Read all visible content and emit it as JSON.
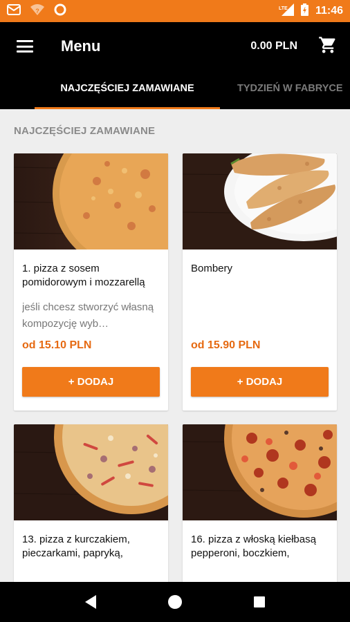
{
  "status_bar": {
    "time": "11:46",
    "network": "LTE",
    "left_icons": [
      "gmail-icon",
      "wifi-question-icon",
      "circle-app-icon"
    ],
    "right_icons": [
      "lte-icon",
      "signal-icon",
      "battery-icon"
    ]
  },
  "app_bar": {
    "title": "Menu",
    "cart_total": "0.00 PLN",
    "menu_icon": "hamburger-icon",
    "cart_icon": "cart-icon"
  },
  "tabs": [
    {
      "label": "NAJCZĘŚCIEJ ZAMAWIANE",
      "active": true
    },
    {
      "label": "TYDZIEŃ W FABRYCE",
      "active": false
    }
  ],
  "section": {
    "title": "NAJCZĘŚCIEJ ZAMAWIANE"
  },
  "products": [
    {
      "title": "1. pizza z sosem pomidorowym i mozzarellą",
      "description": "jeśli chcesz stworzyć własną kompozycję wyb…",
      "price": "od 15.10 PLN",
      "button": "+ DODAJ"
    },
    {
      "title": "Bombery",
      "description": "",
      "price": "od 15.90 PLN",
      "button": "+ DODAJ"
    },
    {
      "title": "13. pizza z kurczakiem, pieczarkami, papryką,",
      "description": "",
      "price": "",
      "button": ""
    },
    {
      "title": "16. pizza z włoską kiełbasą pepperoni, boczkiem,",
      "description": "",
      "price": "",
      "button": ""
    }
  ],
  "colors": {
    "accent": "#f07a1a",
    "price": "#e66a12",
    "app_bar": "#000000",
    "background": "#eeeeee"
  },
  "nav_bar": {
    "icons": [
      "back-icon",
      "home-icon",
      "recents-icon"
    ]
  }
}
